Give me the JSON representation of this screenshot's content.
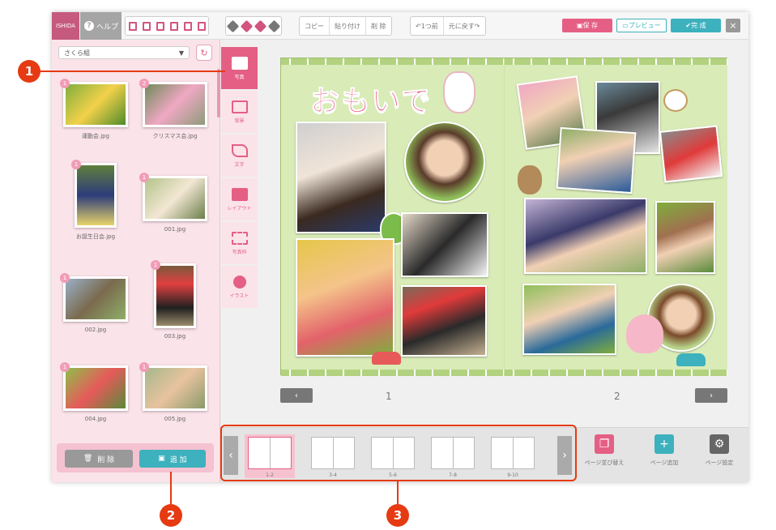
{
  "toolbar": {
    "logo_text": "ISHIDA",
    "help_label": "ヘルプ",
    "copy": "コピー",
    "paste": "貼り付け",
    "delete": "削 除",
    "undo": "1つ前",
    "redo": "元に戻す",
    "save": "保 存",
    "preview": "プレビュー",
    "done": "完 成",
    "close": "×"
  },
  "left_panel": {
    "class_select": "さくら組",
    "photos": [
      {
        "badge": "1",
        "name": "運動会.jpg"
      },
      {
        "badge": "2",
        "name": "クリスマス会.jpg"
      },
      {
        "badge": "1",
        "name": "お誕生日会.jpg"
      },
      {
        "badge": "1",
        "name": "001.jpg"
      },
      {
        "badge": "1",
        "name": "002.jpg"
      },
      {
        "badge": "1",
        "name": "003.jpg"
      },
      {
        "badge": "1",
        "name": "004.jpg"
      },
      {
        "badge": "1",
        "name": "005.jpg"
      }
    ],
    "delete_btn": "削 除",
    "add_btn": "追 加"
  },
  "side_tabs": [
    "写真",
    "背景",
    "文字",
    "レイアウト",
    "写真枠",
    "イラスト"
  ],
  "album": {
    "title": "おもいで",
    "page_left": "1",
    "page_right": "2"
  },
  "strip": {
    "spreads": [
      "1-2",
      "3-4",
      "5-6",
      "7-8",
      "9-10"
    ],
    "actions": [
      "ページ並び替え",
      "ページ追加",
      "ページ設定"
    ]
  },
  "callouts": [
    "1",
    "2",
    "3"
  ],
  "colors": {
    "accent": "#e55f84",
    "teal": "#3db1bd",
    "callout": "#e63a12"
  }
}
